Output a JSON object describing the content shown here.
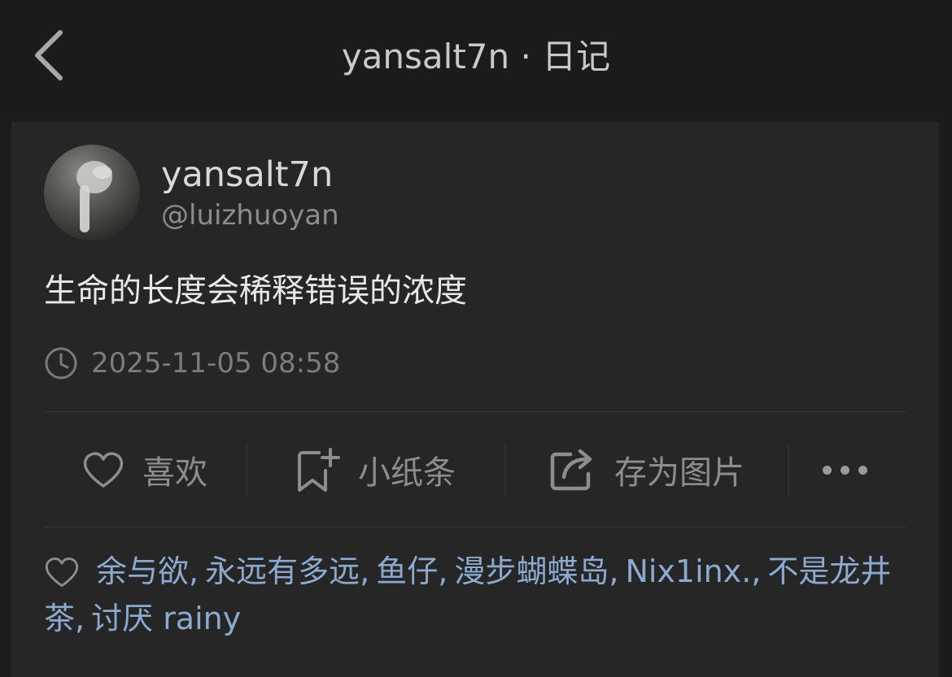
{
  "header": {
    "title": "yansalt7n · 日记",
    "back_icon": "chevron-left-icon"
  },
  "post": {
    "author_name": "yansalt7n",
    "author_handle": "@luizhuoyan",
    "content": "生命的长度会稀释错误的浓度",
    "timestamp": "2025-11-05 08:58"
  },
  "actions": {
    "like_label": "喜欢",
    "note_label": "小纸条",
    "save_image_label": "存为图片",
    "more_icon": "more-dots-icon"
  },
  "likes": {
    "icon": "heart-outline-icon",
    "users": [
      "余与欲",
      "永远有多远",
      "鱼仔",
      "漫步蝴蝶岛",
      "Nix1inx.",
      "不是龙井茶",
      "讨厌 rainy"
    ]
  },
  "colors": {
    "background": "#1b1b1c",
    "card": "#262627",
    "link_blue": "#8caad0",
    "muted_text": "#8d8d8d"
  }
}
